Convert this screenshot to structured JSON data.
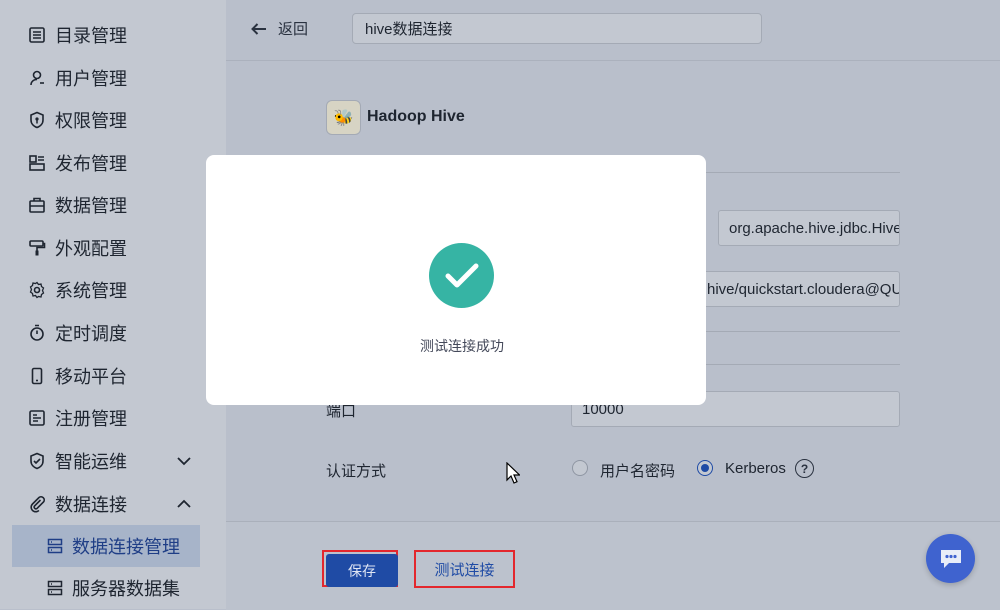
{
  "sidebar": {
    "items": [
      {
        "label": "目录管理",
        "icon": "list-icon"
      },
      {
        "label": "用户管理",
        "icon": "user-icon"
      },
      {
        "label": "权限管理",
        "icon": "shield-icon"
      },
      {
        "label": "发布管理",
        "icon": "layout-icon"
      },
      {
        "label": "数据管理",
        "icon": "briefcase-icon"
      },
      {
        "label": "外观配置",
        "icon": "paint-roller-icon"
      },
      {
        "label": "系统管理",
        "icon": "gear-icon"
      },
      {
        "label": "定时调度",
        "icon": "stopwatch-icon"
      },
      {
        "label": "移动平台",
        "icon": "mobile-icon"
      },
      {
        "label": "注册管理",
        "icon": "register-icon"
      },
      {
        "label": "智能运维",
        "icon": "ops-icon",
        "expanded": false
      },
      {
        "label": "数据连接",
        "icon": "paperclip-icon",
        "expanded": true
      }
    ],
    "subitems": [
      {
        "label": "数据连接管理",
        "icon": "server-icon",
        "active": true
      },
      {
        "label": "服务器数据集",
        "icon": "server-icon",
        "active": false
      }
    ]
  },
  "topbar": {
    "back_label": "返回",
    "connection_name": "hive数据连接"
  },
  "form": {
    "db_title": "Hadoop Hive",
    "logo_text": "🐝",
    "driver_value": "org.apache.hive.jdbc.HiveDriver",
    "url_value": "hive/quickstart.cloudera@QUICKSTART.CLOUDERA",
    "port_label": "端口",
    "port_value": "10000",
    "auth_label": "认证方式",
    "auth_option_password": "用户名密码",
    "auth_option_kerberos": "Kerberos",
    "auth_selected": "Kerberos",
    "help_icon": "?"
  },
  "footer": {
    "save_label": "保存",
    "test_label": "测试连接"
  },
  "modal": {
    "message": "测试连接成功",
    "icon": "check-circle-icon",
    "icon_color": "#36b4a4"
  },
  "colors": {
    "primary": "#1f4ba5",
    "highlight_border": "#e3272d",
    "chat_button": "#3f63cf"
  }
}
